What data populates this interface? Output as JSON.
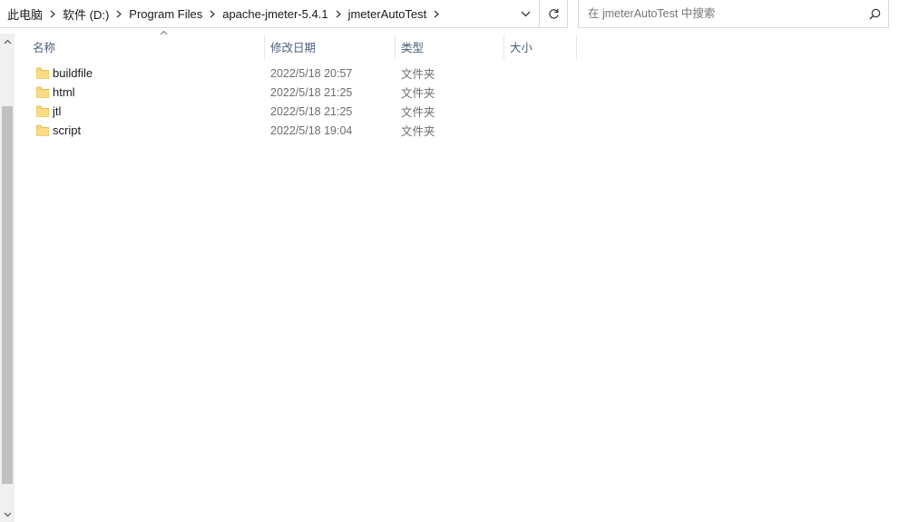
{
  "address": {
    "breadcrumbs": [
      "此电脑",
      "软件 (D:)",
      "Program Files",
      "apache-jmeter-5.4.1",
      "jmeterAutoTest"
    ]
  },
  "search": {
    "placeholder": "在 jmeterAutoTest 中搜索"
  },
  "columns": {
    "name": "名称",
    "modified": "修改日期",
    "type": "类型",
    "size": "大小"
  },
  "files": [
    {
      "name": "buildfile",
      "modified": "2022/5/18 20:57",
      "type": "文件夹",
      "size": ""
    },
    {
      "name": "html",
      "modified": "2022/5/18 21:25",
      "type": "文件夹",
      "size": ""
    },
    {
      "name": "jtl",
      "modified": "2022/5/18 21:25",
      "type": "文件夹",
      "size": ""
    },
    {
      "name": "script",
      "modified": "2022/5/18 19:04",
      "type": "文件夹",
      "size": ""
    }
  ],
  "colors": {
    "header_text": "#4c607a",
    "folder_yellow": "#f8d775",
    "folder_dark": "#e0b13a"
  }
}
